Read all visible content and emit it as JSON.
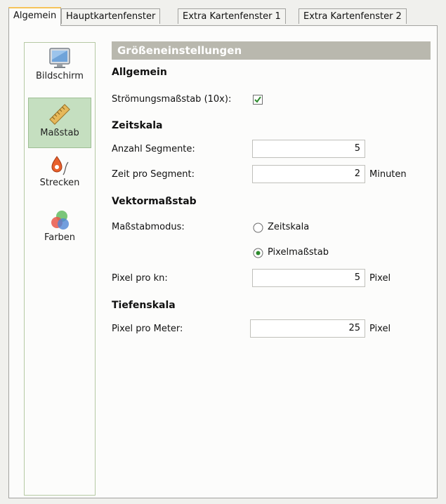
{
  "tabs": [
    {
      "label": "Algemein",
      "active": true
    },
    {
      "label": "Hauptkartenfenster",
      "active": false
    },
    {
      "label": "Extra Kartenfenster 1",
      "active": false
    },
    {
      "label": "Extra Kartenfenster 2",
      "active": false
    }
  ],
  "sidebar": {
    "items": [
      {
        "label": "Bildschirm",
        "icon": "monitor-icon",
        "selected": false
      },
      {
        "label": "Maßstab",
        "icon": "ruler-icon",
        "selected": true
      },
      {
        "label": "Strecken",
        "icon": "route-pin-icon",
        "selected": false
      },
      {
        "label": "Farben",
        "icon": "color-circles-icon",
        "selected": false
      }
    ]
  },
  "content": {
    "section_title": "Größeneinstellungen",
    "allgemein": {
      "heading": "Allgemein",
      "stroemung_label": "Strömungsmaßstab (10x):",
      "stroemung_checked": true
    },
    "zeitskala": {
      "heading": "Zeitskala",
      "segmente_label": "Anzahl Segmente:",
      "segmente_value": "5",
      "zeit_label": "Zeit pro Segment:",
      "zeit_value": "2",
      "zeit_unit": "Minuten"
    },
    "vektor": {
      "heading": "Vektormaßstab",
      "modus_label": "Maßstabmodus:",
      "option_zeitskala": "Zeitskala",
      "option_pixel": "Pixelmaßstab",
      "selected_option": "Pixelmaßstab",
      "pixel_kn_label": "Pixel pro kn:",
      "pixel_kn_value": "5",
      "pixel_kn_unit": "Pixel"
    },
    "tiefen": {
      "heading": "Tiefenskala",
      "pixel_meter_label": "Pixel pro Meter:",
      "pixel_meter_value": "25",
      "pixel_meter_unit": "Pixel"
    }
  },
  "colors": {
    "selected_nav_bg": "#c5dfc0",
    "section_header_bg": "#b9b8ae",
    "active_tab_accent": "#f6c45a",
    "checkmark": "#2c8a2c"
  }
}
